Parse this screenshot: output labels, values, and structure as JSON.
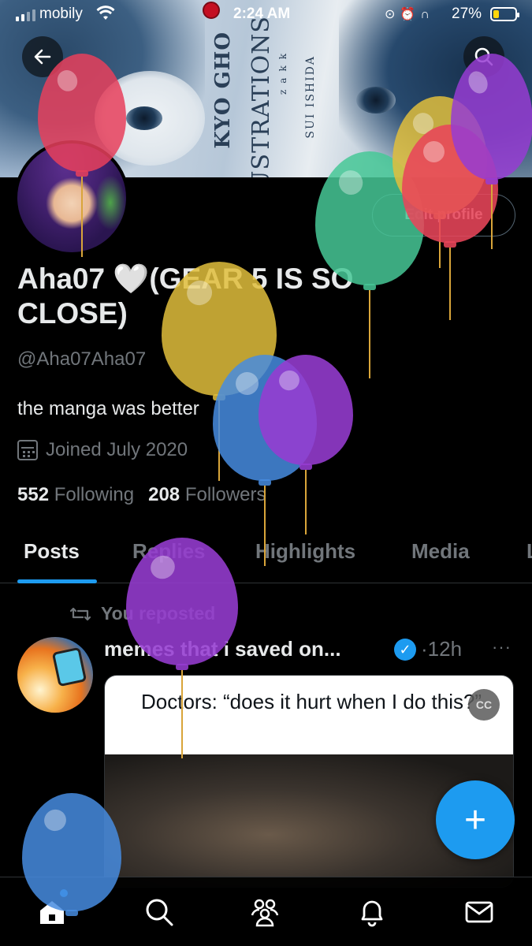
{
  "status_bar": {
    "carrier": "mobily",
    "time": "2:24 AM",
    "battery_pct": "27%",
    "battery_level": 0.27
  },
  "banner": {
    "title_lines": [
      "KYO GHO",
      "ILLUSTRATIONS",
      "zakk",
      "SUI ISHIDA"
    ]
  },
  "header": {
    "back_icon": "arrow-left-icon",
    "search_icon": "search-icon"
  },
  "profile": {
    "edit_label": "Edit profile",
    "name": "Aha07 🤍(GEAR 5 IS SO CLOSE)",
    "handle": "@Aha07Aha07",
    "bio": "the manga was better",
    "joined": "Joined July 2020",
    "following_count": "552",
    "following_label": "Following",
    "followers_count": "208",
    "followers_label": "Followers"
  },
  "tabs": [
    {
      "label": "Posts",
      "active": true
    },
    {
      "label": "Replies",
      "active": false
    },
    {
      "label": "Highlights",
      "active": false
    },
    {
      "label": "Media",
      "active": false
    },
    {
      "label": "L",
      "active": false
    }
  ],
  "post": {
    "repost_text": "You reposted",
    "author": "memes that i saved on...",
    "time": "12h",
    "more": "···",
    "caption": "Doctors: “does it hurt when I do this?”"
  },
  "fab_label": "+",
  "bottom_nav": [
    "home-icon",
    "search-icon",
    "communities-icon",
    "notifications-icon",
    "messages-icon"
  ],
  "colors": {
    "accent": "#1d9bf0",
    "background": "#000000",
    "text_primary": "#e7e9ea",
    "text_secondary": "#71767b"
  }
}
